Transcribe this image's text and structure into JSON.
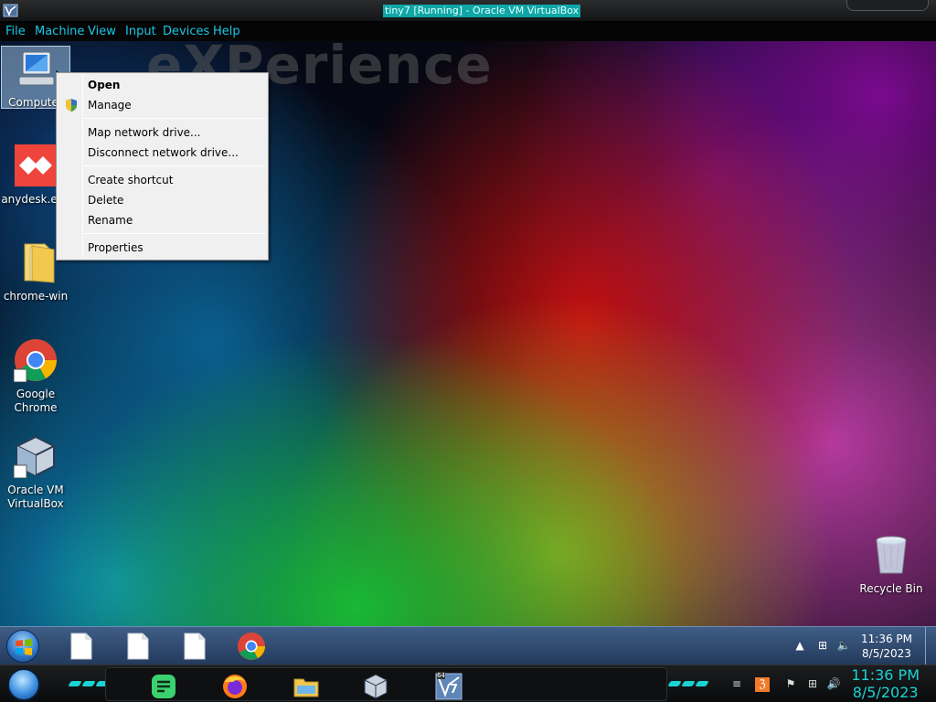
{
  "host": {
    "title": "tiny7 [Running] - Oracle VM VirtualBox",
    "menu": [
      "File",
      "Machine",
      "View",
      "Input",
      "Devices",
      "Help"
    ]
  },
  "desktop": {
    "watermark": "eXPerience",
    "icons": [
      {
        "label": "Computer",
        "icon": "computer-icon",
        "selected": true
      },
      {
        "label": "anydesk.exe",
        "icon": "anydesk-icon"
      },
      {
        "label": "chrome-win",
        "icon": "folder-icon"
      },
      {
        "label": "Google Chrome",
        "icon": "chrome-icon"
      },
      {
        "label": "Oracle VM VirtualBox",
        "icon": "virtualbox-icon"
      },
      {
        "label": "Recycle Bin",
        "icon": "recycle-bin-icon"
      }
    ]
  },
  "context_menu": {
    "items": [
      {
        "label": "Open",
        "bold": true
      },
      {
        "label": "Manage",
        "icon": "uac-shield-icon"
      },
      {
        "label": "Map network drive..."
      },
      {
        "label": "Disconnect network drive..."
      },
      {
        "label": "Create shortcut"
      },
      {
        "label": "Delete"
      },
      {
        "label": "Rename"
      },
      {
        "label": "Properties"
      }
    ]
  },
  "guest_taskbar": {
    "buttons": [
      "blank-document-icon",
      "blank-document-icon",
      "blank-document-icon",
      "chrome-icon"
    ],
    "time": "11:36 PM",
    "date": "8/5/2023"
  },
  "host_taskbar": {
    "apps": [
      "notes-icon",
      "firefox-icon",
      "file-explorer-icon",
      "virtualbox-icon",
      "virtualbox-vm-icon"
    ],
    "vm_badge": "7",
    "vm_badge_top": "64",
    "time": "11:36 PM",
    "date": "8/5/2023"
  },
  "colors": {
    "host_accent": "#19c7e6",
    "title_highlight": "#0fa6a6",
    "menu_bg": "#f0f0f0"
  }
}
